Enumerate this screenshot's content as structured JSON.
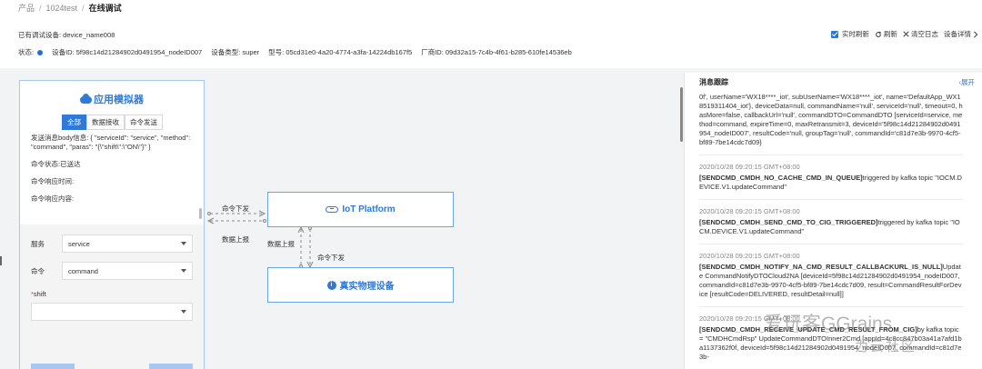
{
  "breadcrumb": {
    "item1": "产品",
    "item2": "1024test",
    "current": "在线调试",
    "sep": "/"
  },
  "device": {
    "label": "已有调试设备: device_name008",
    "status_label": "状态:",
    "device_id": "设备ID: 5f98c14d21284902d0491954_nodeID007",
    "device_type": "设备类型: super",
    "model": "型号: 05cd31e0-4a20-4774-a3fa-14224db167f5",
    "vendor_id": "厂商ID: 09d32a15-7c4b-4f61-b285-610fe14536eb"
  },
  "toolbar": {
    "realtime_refresh": "实时刷新",
    "refresh": "刷新",
    "clear_log": "清空日志",
    "device_detail": "设备详情",
    "refresh_icon": "refresh-icon",
    "close_icon": "close-icon",
    "chevron_icon": "chevron-right-icon"
  },
  "simulator": {
    "title": "应用模拟器",
    "tabs": [
      "全部",
      "数据接收",
      "命令发送"
    ],
    "message_body": "发送消息body信息: { \"serviceId\": \"service\", \"method\": \"command\", \"paras\": \"{\\\"shift\\\":\\\"ON\\\"}\" }",
    "cmd_status": "命令状态:已送达",
    "cmd_response_time": "命令响应时间:",
    "cmd_response_content": "命令响应内容:",
    "form": {
      "service_label": "服务",
      "service_value": "service",
      "command_label": "命令",
      "command_value": "command",
      "shift_required": "*",
      "shift_label": "shift",
      "shift_value": ""
    }
  },
  "diagram": {
    "cmd_send_1": "命令下发",
    "data_report_1": "数据上报",
    "data_report_2": "数据上报",
    "cmd_send_2": "命令下发",
    "iot_platform": "IoT Platform",
    "real_device": "真实物理设备"
  },
  "messages": {
    "title": "消息跟踪",
    "expand": "‹展开",
    "first_block": "0f', userName='WX18****_iot', subUserName='WX18****_iot', name='DefaultApp_WX18519311404_iot'}, deviceData=null, commandName='null', serviceId='null', timeout=0, hasMore=false, callbackUrl='null', commandDTO=CommandDTO [serviceId=service, method=command, expireTime=0, maxRetransmit=3, deviceId='5f98c14d21284902d0491954_nodeID007', resultCode='null, groupTag='null', commandId='c81d7e3b-9970-4cf5-bf89-7be14cdc7d09}",
    "entries": [
      {
        "time": "2020/10/28 09:20:15 GMT+08:00",
        "event": "[SENDCMD_CMDH_NO_CACHE_CMD_IN_QUEUE]",
        "text": "triggered by kafka topic \"IOCM.DEVICE.V1.updateCommand\""
      },
      {
        "time": "2020/10/28 09:20:15 GMT+08:00",
        "event": "[SENDCMD_CMDH_SEND_CMD_TO_CIG_TRIGGERED]",
        "text": "triggered by kafka topic \"IOCM.DEVICE.V1.updateCommand\""
      },
      {
        "time": "2020/10/28 09:20:15 GMT+08:00",
        "event": "[SENDCMD_CMDH_NOTIFY_NA_CMD_RESULT_CALLBACKURL_IS_NULL]",
        "text": "Update CommandNotifyDTOCloud2NA [deviceId=5f98c14d21284902d0491954_nodeID007, commandId=c81d7e3b-9970-4cf5-bf89-7be14cdc7d09, result=CommandResultForDevice [resultCode=DELIVERED, resultDetail=null]]"
      },
      {
        "time": "2020/10/28 09:20:15 GMT+08:00",
        "event": "[SENDCMD_CMDH_RECEIVE_UPDATE_CMD_RESULT_FROM_CIG]",
        "text": "by kafka topic = \"CMDHCmdRsp\" UpdateCommandDTOInner2Cmd [appId=4c8cc847b03a41a7afd1ba1137362f0f, deviceId=5f98c14d21284902d0491954_nodeID007, commandId=c81d7e3b-"
      }
    ]
  },
  "watermark": {
    "line1": "爱玩客GGrains",
    "line2": "为云社区"
  },
  "colors": {
    "accent": "#2f7ad8",
    "panel_border": "#a6c8f0",
    "background": "#f2f3f5"
  }
}
